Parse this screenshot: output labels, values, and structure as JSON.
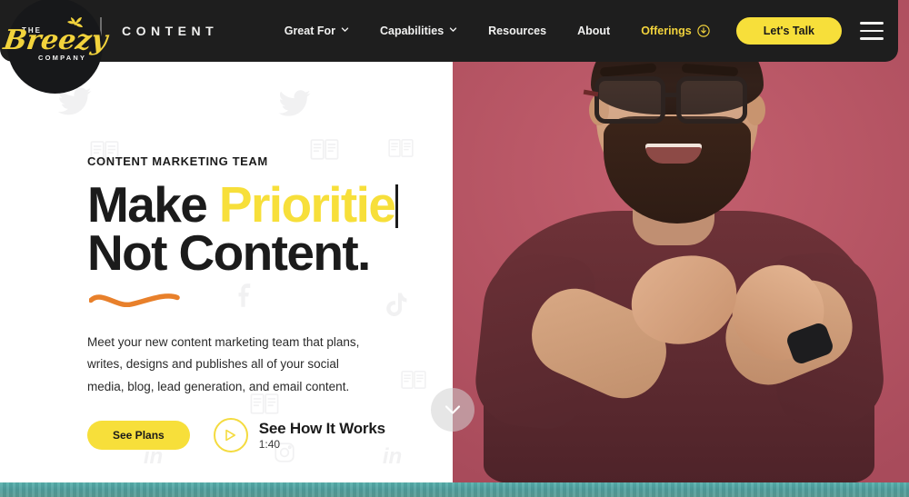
{
  "brand": {
    "logo_the": "THE",
    "logo_script": "Breezy",
    "logo_company": "COMPANY",
    "logo_icon": "pinwheel-icon",
    "word": "CONTENT"
  },
  "nav": {
    "items": [
      {
        "label": "Great For",
        "has_caret": true,
        "accent": false
      },
      {
        "label": "Capabilities",
        "has_caret": true,
        "accent": false
      },
      {
        "label": "Resources",
        "has_caret": false,
        "accent": false
      },
      {
        "label": "About",
        "has_caret": false,
        "accent": false
      },
      {
        "label": "Offerings",
        "has_caret": false,
        "accent": true,
        "icon": "download-circle-icon"
      }
    ],
    "cta_label": "Let's Talk",
    "menu_icon": "hamburger-menu-icon"
  },
  "hero": {
    "eyebrow": "CONTENT MARKETING TEAM",
    "headline_line1_static": "Make ",
    "headline_line1_typed": "Prioritie",
    "headline_line2": "Not Content.",
    "body": "Meet your new content marketing team that plans, writes, designs and publishes all of your social media, blog, lead generation, and email content.",
    "primary_cta": "See Plans",
    "video_title": "See How It Works",
    "video_duration": "1:40",
    "play_icon": "play-circle-icon",
    "squiggle_icon": "orange-squiggle-underline",
    "scroll_icon": "chevron-down-icon",
    "photo_alt": "bearded-man-with-glasses-clapping"
  },
  "watermarks": [
    "twitter-bird-icon",
    "facebook-f-icon",
    "instagram-icon",
    "linkedin-in-icon",
    "document-icon",
    "tiktok-icon"
  ],
  "colors": {
    "nav_bg": "#1e1e1e",
    "accent_yellow": "#f7df3a",
    "logo_yellow": "#f2d33c",
    "photo_pink": "#b55463",
    "squiggle_orange": "#e8802b",
    "teal_strip": "#57b0ad",
    "text_dark": "#1b1b1b"
  }
}
